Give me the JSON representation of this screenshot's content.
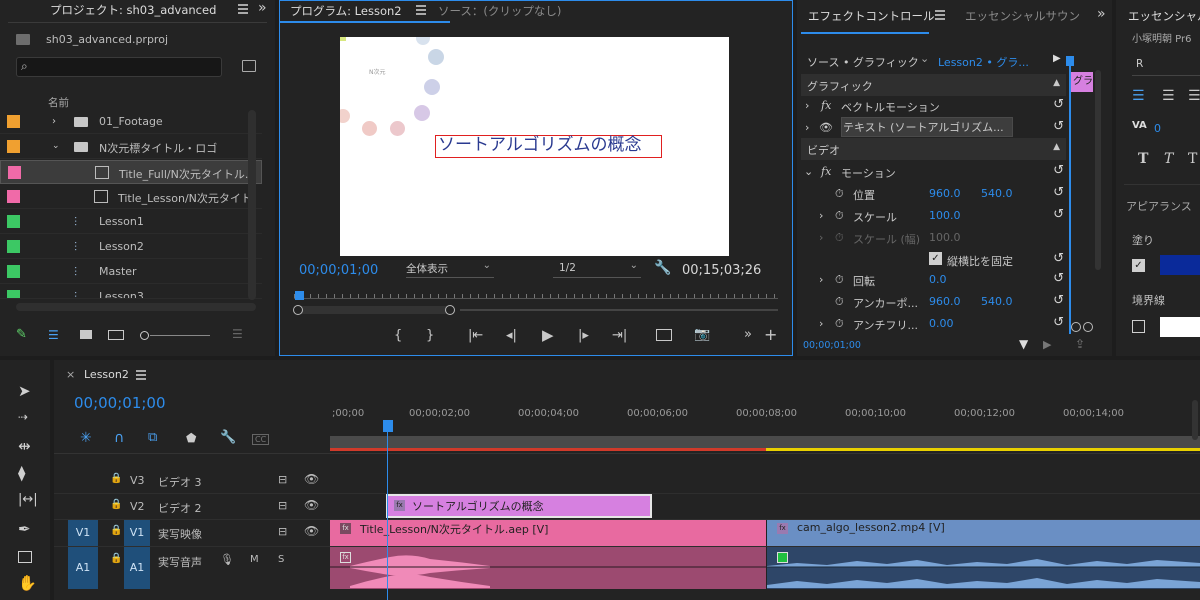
{
  "project": {
    "tab_title": "プロジェクト: sh03_advanced",
    "file_name": "sh03_advanced.prproj",
    "search_placeholder": "",
    "column_name": "名前",
    "items": [
      {
        "name": "01_Footage",
        "color": "#f0a030",
        "type": "folder"
      },
      {
        "name": "N次元標タイトル・ロゴ",
        "color": "#f0a030",
        "type": "folder"
      },
      {
        "name": "Title_Full/N次元タイトル.",
        "color": "#f06aa8",
        "type": "comp"
      },
      {
        "name": "Title_Lesson/N次元タイト",
        "color": "#f06aa8",
        "type": "comp"
      },
      {
        "name": "Lesson1",
        "color": "#3cc864",
        "type": "sequence"
      },
      {
        "name": "Lesson2",
        "color": "#3cc864",
        "type": "sequence"
      },
      {
        "name": "Master",
        "color": "#3cc864",
        "type": "sequence"
      },
      {
        "name": "Lesson3",
        "color": "#3cc864",
        "type": "sequence"
      }
    ]
  },
  "program": {
    "tab_title": "プログラム: Lesson2",
    "source_tab": "ソース：(クリップなし)",
    "timecode": "00;00;01;00",
    "zoom": "全体表示",
    "resolution": "1/2",
    "duration": "00;15;03;26",
    "frame_small_text": "N次元",
    "frame_title": "ソートアルゴリズムの概念"
  },
  "effect_controls": {
    "tab_title": "エフェクトコントロール",
    "essential_tab": "エッセンシャルサウン",
    "source_label": "ソース • グラフィック",
    "seq_label": "Lesson2 • グラ...",
    "mini_clip": "グラ",
    "section_graphic": "グラフィック",
    "vector_motion": "ベクトルモーション",
    "text_layer": "テキスト (ソートアルゴリズム...",
    "section_video": "ビデオ",
    "motion": "モーション",
    "position_label": "位置",
    "position_x": "960.0",
    "position_y": "540.0",
    "scale_label": "スケール",
    "scale_value": "100.0",
    "scale_width_label": "スケール (幅)",
    "scale_width_value": "100.0",
    "lock_ratio": "縦横比を固定",
    "rotation_label": "回転",
    "rotation_value": "0.0",
    "anchor_label": "アンカーポ...",
    "anchor_x": "960.0",
    "anchor_y": "540.0",
    "antiflicker_label": "アンチフリ...",
    "antiflicker_value": "0.00",
    "footer_timecode": "00;00;01;00"
  },
  "essential": {
    "tab_title": "エッセンシャル",
    "font_name": "小塚明朝 Pr6",
    "font_style": "R",
    "tracking_value": "0",
    "section_appearance": "アピアランス",
    "fill_label": "塗り",
    "fill_color": "#0a2a9a",
    "stroke_label": "境界線",
    "stroke_color": "#ffffff"
  },
  "timeline": {
    "tab_title": "Lesson2",
    "timecode": "00;00;01;00",
    "ruler": [
      ";00;00",
      "00;00;02;00",
      "00;00;04;00",
      "00;00;06;00",
      "00;00;08;00",
      "00;00;10;00",
      "00;00;12;00",
      "00;00;14;00"
    ],
    "tracks": [
      {
        "id": "V3",
        "name": "ビデオ 3"
      },
      {
        "id": "V2",
        "name": "ビデオ 2"
      },
      {
        "id": "V1",
        "name": "実写映像",
        "src": "V1"
      },
      {
        "id": "A1",
        "name": "実写音声",
        "src": "A1"
      }
    ],
    "clips": {
      "graphic": "ソートアルゴリズムの概念",
      "v1_a": "Title_Lesson/N次元タイトル.aep [V]",
      "v1_b": "cam_algo_lesson2.mp4 [V]"
    },
    "mute": "M",
    "solo": "S"
  },
  "colors": {
    "accent_blue": "#2d8ceb",
    "clip_pink": "#e86aa0",
    "clip_blue": "#6a8fc4",
    "graphic_clip": "#d680e0"
  }
}
